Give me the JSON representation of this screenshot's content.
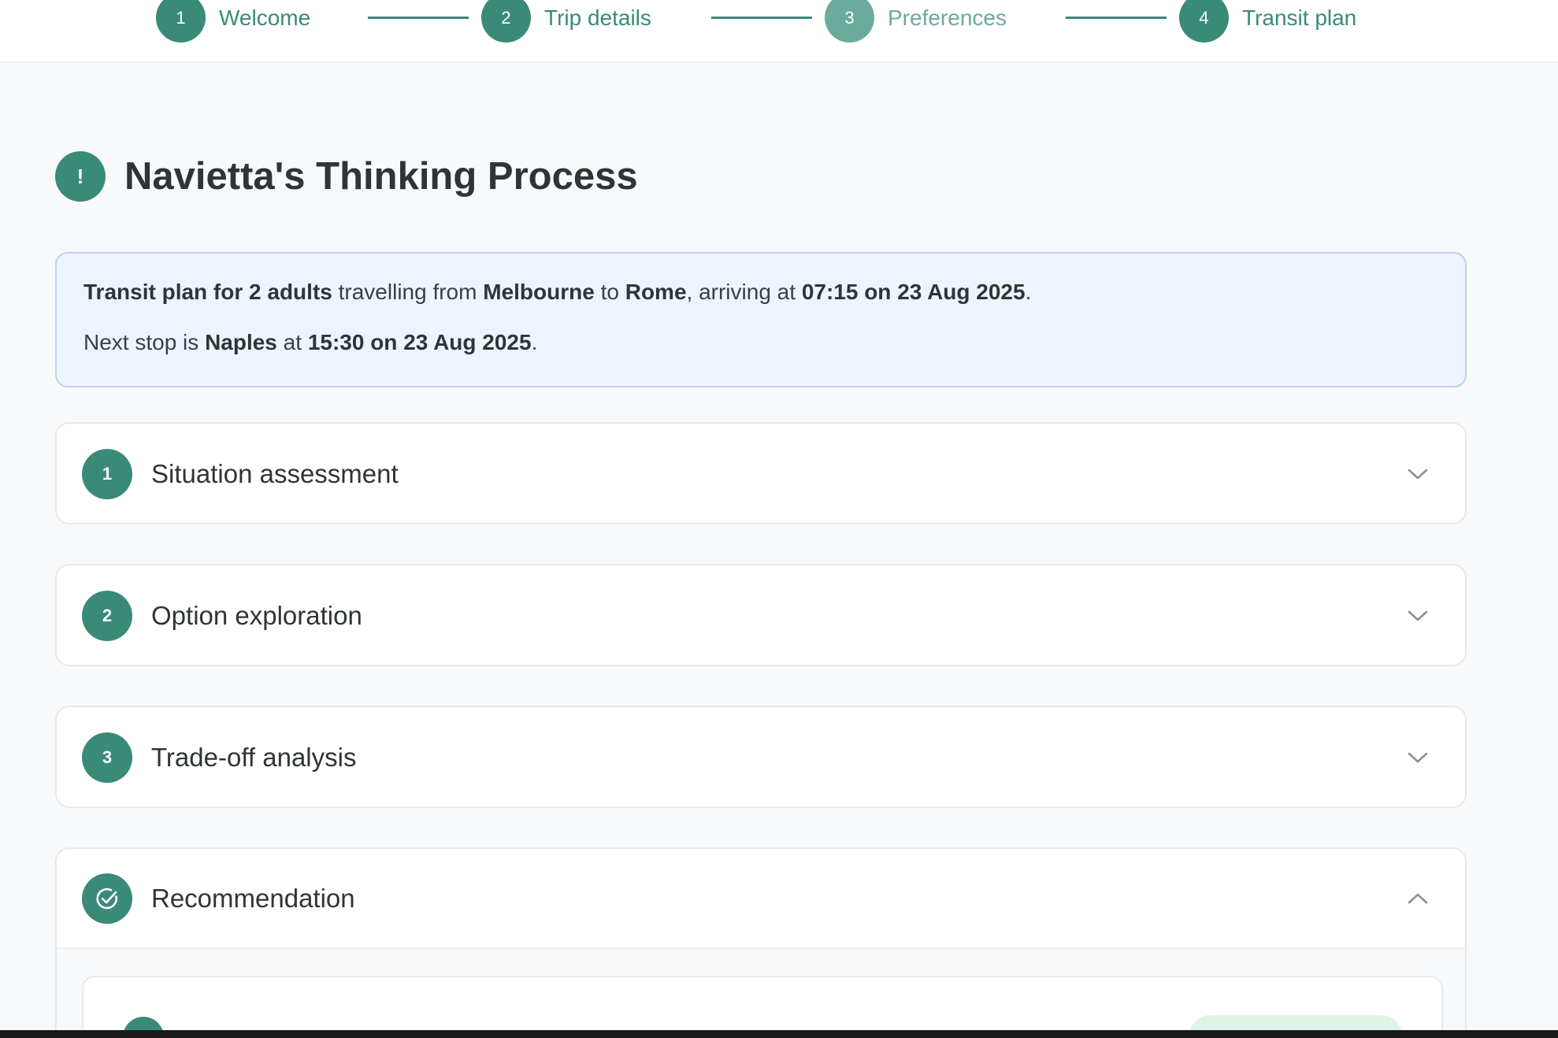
{
  "stepper": {
    "steps": [
      {
        "number": "1",
        "label": "Welcome"
      },
      {
        "number": "2",
        "label": "Trip details"
      },
      {
        "number": "3",
        "label": "Preferences"
      },
      {
        "number": "4",
        "label": "Transit plan"
      }
    ]
  },
  "heading": {
    "icon_glyph": "!",
    "title": "Navietta's Thinking Process"
  },
  "summary": {
    "line1": {
      "part1_bold": "Transit plan for 2 adults",
      "part2": " travelling from ",
      "part3_bold": "Melbourne",
      "part4": " to ",
      "part5_bold": "Rome",
      "part6": ", arriving at ",
      "part7_bold": "07:15 on 23 Aug 2025",
      "part8": "."
    },
    "line2": {
      "part1": "Next stop is ",
      "part2_bold": "Naples",
      "part3": " at ",
      "part4_bold": "15:30 on 23 Aug 2025",
      "part5": "."
    }
  },
  "sections": [
    {
      "number": "1",
      "title": "Situation assessment",
      "expanded": false
    },
    {
      "number": "2",
      "title": "Option exploration",
      "expanded": false
    },
    {
      "number": "3",
      "title": "Trade-off analysis",
      "expanded": false
    },
    {
      "icon": "check-circle-icon",
      "title": "Recommendation",
      "expanded": true
    }
  ],
  "colors": {
    "accent": "#3a8a78",
    "accent_light": "#6aab9c",
    "summary_bg": "#edf4fe",
    "summary_border": "#bcd3f0",
    "badge_bg": "#dff4e6"
  }
}
